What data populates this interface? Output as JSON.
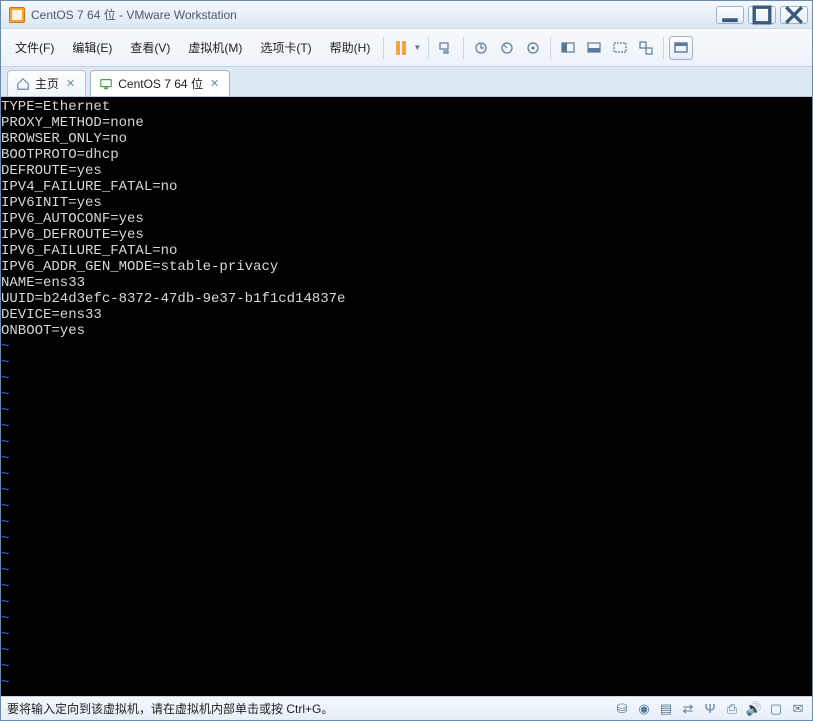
{
  "titlebar": {
    "title": "CentOS 7 64 位 - VMware Workstation"
  },
  "menu": {
    "file": "文件(F)",
    "edit": "编辑(E)",
    "view": "查看(V)",
    "vm": "虚拟机(M)",
    "tabs": "选项卡(T)",
    "help": "帮助(H)"
  },
  "tabs": {
    "home": "主页",
    "vm_tab": "CentOS 7 64 位"
  },
  "terminal": {
    "lines": [
      "TYPE=Ethernet",
      "PROXY_METHOD=none",
      "BROWSER_ONLY=no",
      "BOOTPROTO=dhcp",
      "DEFROUTE=yes",
      "IPV4_FAILURE_FATAL=no",
      "IPV6INIT=yes",
      "IPV6_AUTOCONF=yes",
      "IPV6_DEFROUTE=yes",
      "IPV6_FAILURE_FATAL=no",
      "IPV6_ADDR_GEN_MODE=stable-privacy",
      "NAME=ens33",
      "UUID=b24d3efc-8372-47db-9e37-b1f1cd14837e",
      "DEVICE=ens33",
      "ONBOOT=yes"
    ],
    "tilde_count": 22
  },
  "statusbar": {
    "text": "要将输入定向到该虚拟机，请在虚拟机内部单击或按 Ctrl+G。"
  }
}
